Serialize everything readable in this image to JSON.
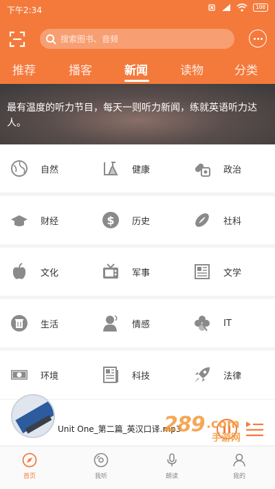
{
  "status": {
    "time": "下午2:34",
    "battery": "100"
  },
  "search": {
    "placeholder": "搜索图书、音频"
  },
  "tabs": [
    {
      "label": "推荐",
      "active": false
    },
    {
      "label": "播客",
      "active": false
    },
    {
      "label": "新闻",
      "active": true
    },
    {
      "label": "读物",
      "active": false
    },
    {
      "label": "分类",
      "active": false
    }
  ],
  "banner": {
    "text": "最有温度的听力节目，每天一则听力新闻，练就英语听力达人。"
  },
  "categories": [
    [
      {
        "label": "自然",
        "icon": "globe-icon"
      },
      {
        "label": "健康",
        "icon": "flask-icon"
      },
      {
        "label": "政治",
        "icon": "pill-icon"
      }
    ],
    [
      {
        "label": "财经",
        "icon": "graduation-cap-icon"
      },
      {
        "label": "历史",
        "icon": "dollar-icon"
      },
      {
        "label": "社科",
        "icon": "football-icon"
      }
    ],
    [
      {
        "label": "文化",
        "icon": "apple-icon"
      },
      {
        "label": "军事",
        "icon": "tv-icon"
      },
      {
        "label": "文学",
        "icon": "newspaper-icon"
      }
    ],
    [
      {
        "label": "生活",
        "icon": "trash-icon"
      },
      {
        "label": "情感",
        "icon": "person-icon"
      },
      {
        "label": "IT",
        "icon": "clover-icon"
      }
    ],
    [
      {
        "label": "环境",
        "icon": "money-icon"
      },
      {
        "label": "科技",
        "icon": "document-icon"
      },
      {
        "label": "法律",
        "icon": "rocket-icon"
      }
    ]
  ],
  "player": {
    "title": "Unit One_第二篇_英汉口译.mp3"
  },
  "nav": [
    {
      "label": "首页",
      "icon": "compass-icon",
      "active": true
    },
    {
      "label": "我听",
      "icon": "disc-icon",
      "active": false
    },
    {
      "label": "朗读",
      "icon": "mic-icon",
      "active": false
    },
    {
      "label": "我的",
      "icon": "user-icon",
      "active": false
    }
  ],
  "watermark": {
    "number": "289",
    "suffix": ".com",
    "text": "手游网"
  },
  "colors": {
    "accent": "#f47a3c",
    "icon_gray": "#8a8a8a"
  }
}
